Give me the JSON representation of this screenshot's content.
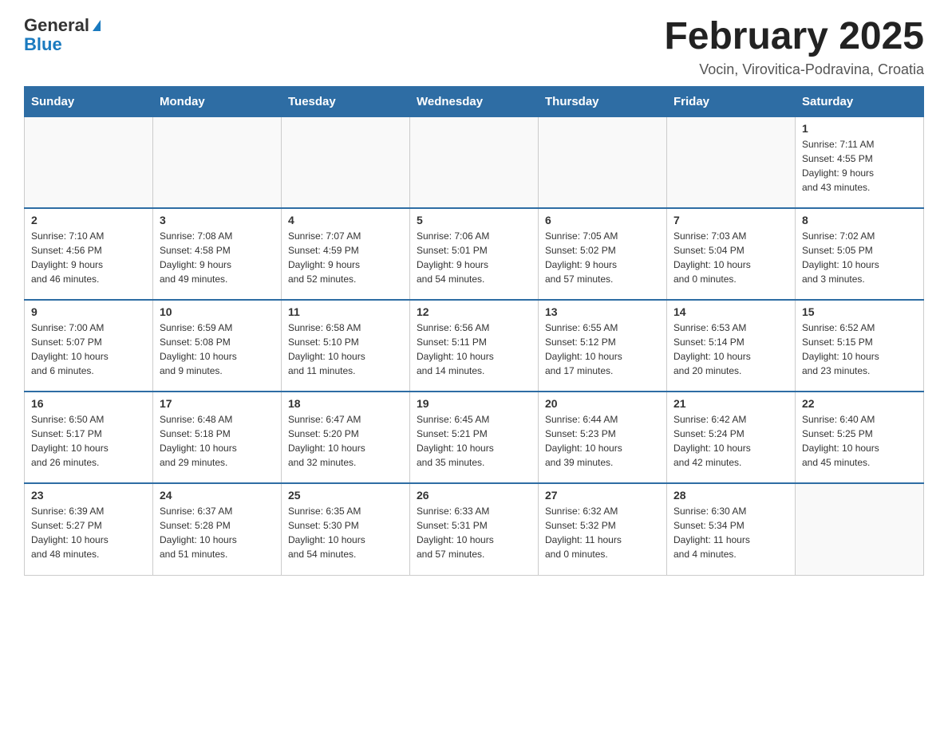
{
  "header": {
    "logo_general": "General",
    "logo_blue": "Blue",
    "month_title": "February 2025",
    "location": "Vocin, Virovitica-Podravina, Croatia"
  },
  "weekdays": [
    "Sunday",
    "Monday",
    "Tuesday",
    "Wednesday",
    "Thursday",
    "Friday",
    "Saturday"
  ],
  "weeks": [
    [
      {
        "day": "",
        "info": ""
      },
      {
        "day": "",
        "info": ""
      },
      {
        "day": "",
        "info": ""
      },
      {
        "day": "",
        "info": ""
      },
      {
        "day": "",
        "info": ""
      },
      {
        "day": "",
        "info": ""
      },
      {
        "day": "1",
        "info": "Sunrise: 7:11 AM\nSunset: 4:55 PM\nDaylight: 9 hours\nand 43 minutes."
      }
    ],
    [
      {
        "day": "2",
        "info": "Sunrise: 7:10 AM\nSunset: 4:56 PM\nDaylight: 9 hours\nand 46 minutes."
      },
      {
        "day": "3",
        "info": "Sunrise: 7:08 AM\nSunset: 4:58 PM\nDaylight: 9 hours\nand 49 minutes."
      },
      {
        "day": "4",
        "info": "Sunrise: 7:07 AM\nSunset: 4:59 PM\nDaylight: 9 hours\nand 52 minutes."
      },
      {
        "day": "5",
        "info": "Sunrise: 7:06 AM\nSunset: 5:01 PM\nDaylight: 9 hours\nand 54 minutes."
      },
      {
        "day": "6",
        "info": "Sunrise: 7:05 AM\nSunset: 5:02 PM\nDaylight: 9 hours\nand 57 minutes."
      },
      {
        "day": "7",
        "info": "Sunrise: 7:03 AM\nSunset: 5:04 PM\nDaylight: 10 hours\nand 0 minutes."
      },
      {
        "day": "8",
        "info": "Sunrise: 7:02 AM\nSunset: 5:05 PM\nDaylight: 10 hours\nand 3 minutes."
      }
    ],
    [
      {
        "day": "9",
        "info": "Sunrise: 7:00 AM\nSunset: 5:07 PM\nDaylight: 10 hours\nand 6 minutes."
      },
      {
        "day": "10",
        "info": "Sunrise: 6:59 AM\nSunset: 5:08 PM\nDaylight: 10 hours\nand 9 minutes."
      },
      {
        "day": "11",
        "info": "Sunrise: 6:58 AM\nSunset: 5:10 PM\nDaylight: 10 hours\nand 11 minutes."
      },
      {
        "day": "12",
        "info": "Sunrise: 6:56 AM\nSunset: 5:11 PM\nDaylight: 10 hours\nand 14 minutes."
      },
      {
        "day": "13",
        "info": "Sunrise: 6:55 AM\nSunset: 5:12 PM\nDaylight: 10 hours\nand 17 minutes."
      },
      {
        "day": "14",
        "info": "Sunrise: 6:53 AM\nSunset: 5:14 PM\nDaylight: 10 hours\nand 20 minutes."
      },
      {
        "day": "15",
        "info": "Sunrise: 6:52 AM\nSunset: 5:15 PM\nDaylight: 10 hours\nand 23 minutes."
      }
    ],
    [
      {
        "day": "16",
        "info": "Sunrise: 6:50 AM\nSunset: 5:17 PM\nDaylight: 10 hours\nand 26 minutes."
      },
      {
        "day": "17",
        "info": "Sunrise: 6:48 AM\nSunset: 5:18 PM\nDaylight: 10 hours\nand 29 minutes."
      },
      {
        "day": "18",
        "info": "Sunrise: 6:47 AM\nSunset: 5:20 PM\nDaylight: 10 hours\nand 32 minutes."
      },
      {
        "day": "19",
        "info": "Sunrise: 6:45 AM\nSunset: 5:21 PM\nDaylight: 10 hours\nand 35 minutes."
      },
      {
        "day": "20",
        "info": "Sunrise: 6:44 AM\nSunset: 5:23 PM\nDaylight: 10 hours\nand 39 minutes."
      },
      {
        "day": "21",
        "info": "Sunrise: 6:42 AM\nSunset: 5:24 PM\nDaylight: 10 hours\nand 42 minutes."
      },
      {
        "day": "22",
        "info": "Sunrise: 6:40 AM\nSunset: 5:25 PM\nDaylight: 10 hours\nand 45 minutes."
      }
    ],
    [
      {
        "day": "23",
        "info": "Sunrise: 6:39 AM\nSunset: 5:27 PM\nDaylight: 10 hours\nand 48 minutes."
      },
      {
        "day": "24",
        "info": "Sunrise: 6:37 AM\nSunset: 5:28 PM\nDaylight: 10 hours\nand 51 minutes."
      },
      {
        "day": "25",
        "info": "Sunrise: 6:35 AM\nSunset: 5:30 PM\nDaylight: 10 hours\nand 54 minutes."
      },
      {
        "day": "26",
        "info": "Sunrise: 6:33 AM\nSunset: 5:31 PM\nDaylight: 10 hours\nand 57 minutes."
      },
      {
        "day": "27",
        "info": "Sunrise: 6:32 AM\nSunset: 5:32 PM\nDaylight: 11 hours\nand 0 minutes."
      },
      {
        "day": "28",
        "info": "Sunrise: 6:30 AM\nSunset: 5:34 PM\nDaylight: 11 hours\nand 4 minutes."
      },
      {
        "day": "",
        "info": ""
      }
    ]
  ]
}
